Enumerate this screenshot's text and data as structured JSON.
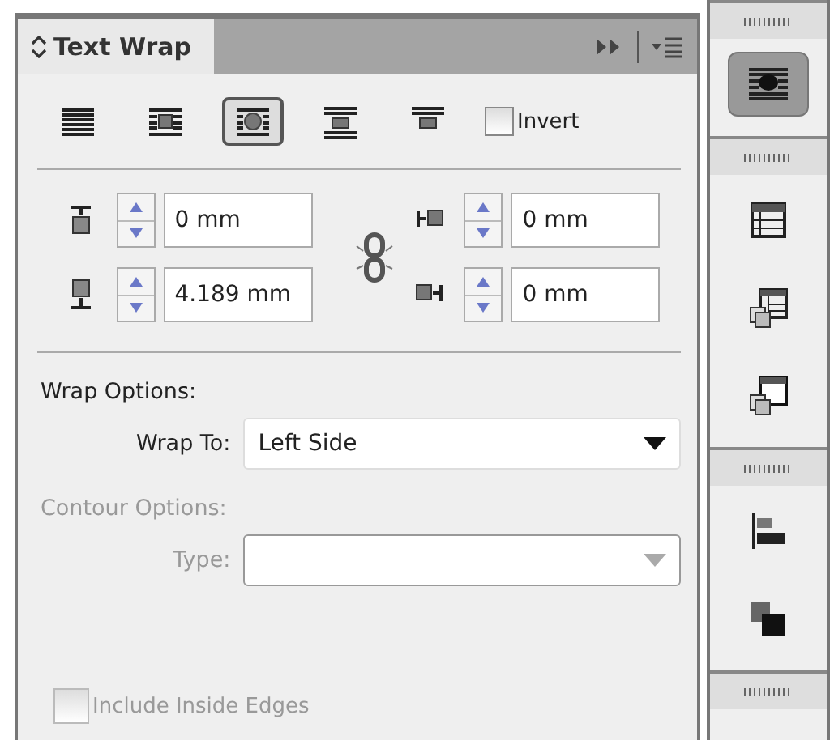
{
  "panel": {
    "tab": {
      "title": "Text Wrap",
      "selected": true
    }
  },
  "wrap_modes": [
    {
      "kind": "none",
      "selected": false
    },
    {
      "kind": "box",
      "selected": false
    },
    {
      "kind": "shape",
      "selected": true
    },
    {
      "kind": "jump",
      "selected": false
    },
    {
      "kind": "column",
      "selected": false
    }
  ],
  "invert": {
    "label": "Invert",
    "checked": false
  },
  "offsets": [
    {
      "kind": "top",
      "value": "0 mm"
    },
    {
      "kind": "left",
      "value": "0 mm"
    },
    {
      "kind": "bottom",
      "value": "4.189 mm"
    },
    {
      "kind": "right",
      "value": "0 mm"
    }
  ],
  "wrap_options": {
    "heading": "Wrap Options:",
    "wrap_to": {
      "label": "Wrap To:",
      "value": "Left Side"
    }
  },
  "contour_options": {
    "heading": "Contour Options:",
    "disabled": true,
    "type": {
      "label": "Type:"
    }
  },
  "include_inside_edges": {
    "label": "Include Inside Edges",
    "checked": false,
    "disabled": true
  },
  "dock": {
    "groups": [
      {
        "items": [
          {
            "kind": "text-wrap",
            "selected": true
          }
        ]
      },
      {
        "items": [
          {
            "kind": "table",
            "selected": false
          },
          {
            "kind": "cell-styles",
            "selected": false
          },
          {
            "kind": "table-styles",
            "selected": false
          }
        ]
      },
      {
        "items": [
          {
            "kind": "align",
            "selected": false
          },
          {
            "kind": "pathfinder",
            "selected": false
          }
        ]
      }
    ]
  }
}
